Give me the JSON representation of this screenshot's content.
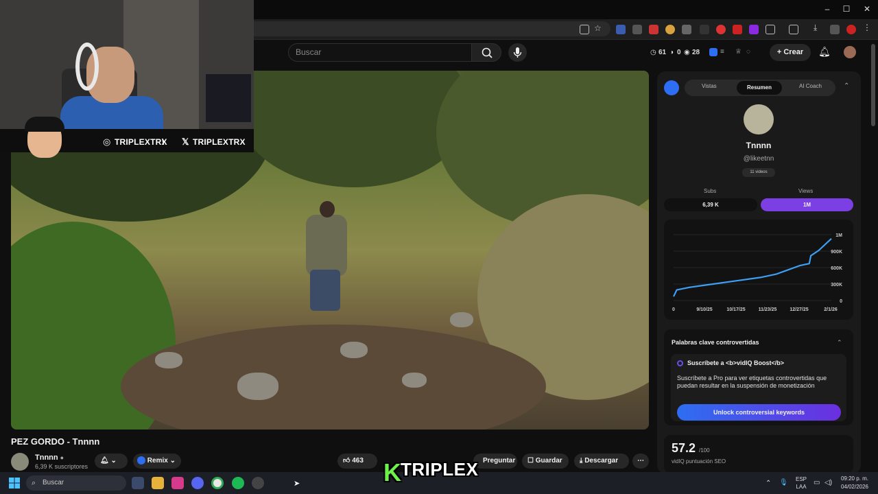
{
  "browser": {
    "window_controls": [
      "–",
      "☐",
      "✕"
    ]
  },
  "header": {
    "search_placeholder": "Buscar",
    "stat_a": "61",
    "stat_b": "0",
    "stat_c": "28",
    "create_label": "Crear"
  },
  "overlay": {
    "instagram": "TRIPLEXTRX",
    "separator": "\\",
    "x_handle": "TRIPLEXTRX",
    "logo_k": "K",
    "logo_text": "TRIPLEX"
  },
  "video": {
    "title": "PEZ GORDO - Tnnnn",
    "channel": "Tnnnn",
    "subs": "6,39 K suscriptores",
    "remix": "Remix",
    "likes": "463",
    "ask": "Preguntar",
    "save": "Guardar",
    "download": "Descargar",
    "more": "⋯"
  },
  "vidiq": {
    "tabs": [
      "Vistas",
      "Resumen",
      "AI Coach"
    ],
    "channel_name": "Tnnnn",
    "handle": "@likeetnn",
    "videos": "11 videos",
    "subs_label": "Subs",
    "views_label": "Views",
    "subs_value": "6,39 K",
    "views_value": "1M",
    "kw_title": "Palabras clave controvertidas",
    "sub_head": "Suscríbete a <b>vidIQ Boost</b>",
    "sub_body": "Suscríbete a Pro para ver etiquetas controvertidas que puedan resultar en la suspensión de monetización",
    "unlock": "Unlock controversial keywords",
    "seo_value": "57.2",
    "seo_max": "/100",
    "seo_label": "vidIQ puntuación SEO"
  },
  "chart_data": {
    "type": "line",
    "x": [
      "9/10/25",
      "10/17/25",
      "11/23/25",
      "12/27/25",
      "2/1/26"
    ],
    "x_first_label": "0",
    "y_ticks": [
      "1M",
      "900K",
      "600K",
      "300K",
      "0"
    ],
    "ylim": [
      0,
      1000000
    ],
    "color": "#3da0f5",
    "points": [
      [
        0,
        60000
      ],
      [
        0.02,
        160000
      ],
      [
        0.1,
        200000
      ],
      [
        0.25,
        250000
      ],
      [
        0.4,
        300000
      ],
      [
        0.55,
        350000
      ],
      [
        0.65,
        400000
      ],
      [
        0.8,
        530000
      ],
      [
        0.86,
        560000
      ],
      [
        0.87,
        680000
      ],
      [
        0.92,
        760000
      ],
      [
        1.0,
        940000
      ]
    ]
  },
  "taskbar": {
    "search_placeholder": "Buscar",
    "lang": "ESP",
    "lang_sub": "LAA",
    "time": "09:20 p. m.",
    "date": "04/02/2026"
  }
}
